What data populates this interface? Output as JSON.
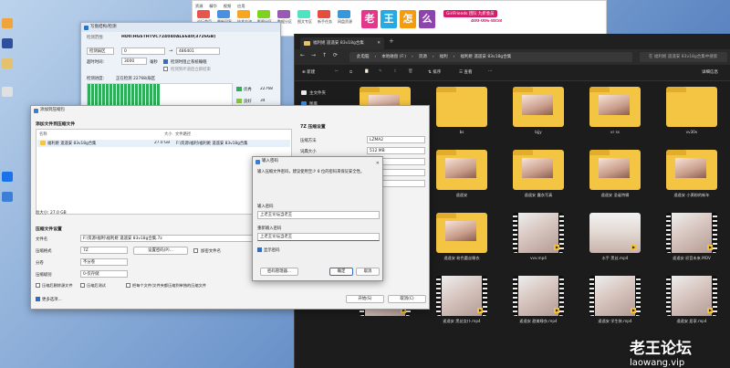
{
  "desktop": {
    "icon_colors": [
      "#f0a43a",
      "#2f4f9c",
      "#e4c16a",
      "#e0e0e0",
      "#1a73e8",
      "#3b7fd6"
    ]
  },
  "browser": {
    "nav_links": [
      "资源",
      "精华",
      "视频",
      "应用"
    ],
    "nav_labels": [
      "论坛首页",
      "最新回复",
      "技术交流",
      "影视分区",
      "数据分区",
      "图文专区",
      "新手任务",
      "网盘资源",
      "资源分区",
      "个人中心",
      "签到",
      "设置"
    ],
    "banner_glyphs": [
      "老",
      "王",
      "怎",
      "么"
    ],
    "banner_tag": "GirlFriends 团队 九折会员",
    "banner_phone": "400-006-8858"
  },
  "disk_window": {
    "title": "写盘结构/检测",
    "disk_label": "HD0:HGSTHTVC724040ALE640(3726GB)",
    "mode_label": "检测范围",
    "mode_value": "检测扇区",
    "start_value": "0",
    "arrow": "→",
    "end_value": "486401",
    "timeout_label": "超时时间:",
    "timeout_value": "3000",
    "timeout_unit": "毫秒",
    "option1": "检测时阻止系统睡眠",
    "option2": "检测到坏道后立即结束",
    "progress_label": "检测进度:",
    "progress_status": "正在检测 22768/扇区",
    "progress_fraction": 0.5,
    "legend": [
      {
        "label": "优秀",
        "value": "22768"
      },
      {
        "label": "良好",
        "value": "34"
      }
    ]
  },
  "explorer": {
    "tab_title": "福利姬 遥遥安 83v18g合集",
    "breadcrumb": [
      "此电脑",
      "本地磁盘 (F:)",
      "资源",
      "福利",
      "福利姬 遥遥安 83v18g合集"
    ],
    "search_placeholder": "在 福利姬 遥遥安 83v18g合集中搜索",
    "commands": {
      "new": "新建",
      "sort": "排序",
      "view": "查看",
      "details": "详细信息"
    },
    "nav": [
      {
        "label": "主文件夹",
        "color": "#e8e8e8"
      },
      {
        "label": "图库",
        "color": "#3b8be0"
      }
    ],
    "items": [
      {
        "name": "",
        "type": "folder-photo"
      },
      {
        "name": "bs",
        "type": "folder"
      },
      {
        "name": "bjjy",
        "type": "folder-photo"
      },
      {
        "name": "vr ss",
        "type": "folder-photo"
      },
      {
        "name": "vv30v",
        "type": "folder"
      },
      {
        "name": "",
        "type": "folder-photo"
      },
      {
        "name": "遥遥安",
        "type": "folder-photo"
      },
      {
        "name": "遥遥安 露衣写真",
        "type": "folder-photo"
      },
      {
        "name": "遥遥安 圣诞特辑",
        "type": "folder-photo"
      },
      {
        "name": "遥遥安 小黄粉的新年",
        "type": "folder-photo"
      },
      {
        "name": "",
        "type": "folder"
      },
      {
        "name": "遥遥安 粉色蕾丝睡衣",
        "type": "folder-photo"
      },
      {
        "name": "vvv.mp4",
        "type": "video"
      },
      {
        "name": "水手 黑丝.mp4",
        "type": "portrait"
      },
      {
        "name": "遥遥安 初音未来.MOV",
        "type": "video"
      },
      {
        "name": "",
        "type": "video"
      },
      {
        "name": "遥遥安 黑丝女仆.mp4",
        "type": "video"
      },
      {
        "name": "遥遥安 甜美睡衣.mp4",
        "type": "video"
      },
      {
        "name": "遥遥安 学生装.mp4",
        "type": "video"
      },
      {
        "name": "遥遥安 居家.mp4",
        "type": "video"
      }
    ]
  },
  "archive_dialog": {
    "title": "添加到压缩包",
    "section_files": "添加文件到压缩文件",
    "columns": [
      "名称",
      "大小",
      "文件路径"
    ],
    "rows": [
      {
        "name": "福利姬 遥遥安 83v18g合集",
        "size": "27.0 GB",
        "path": "F:\\资源\\福利\\福利姬 遥遥安 83v18g合集"
      }
    ],
    "total": "总大小: 27.0 GB",
    "add_btn": "添加(A)",
    "section_settings": "压缩文件设置",
    "fields": [
      {
        "label": "文件名",
        "value": "F:\\资源\\福利\\福利姬 遥遥安 83v18g合集.7z"
      },
      {
        "label": "压缩格式",
        "value": "7Z"
      },
      {
        "label": "分卷",
        "value": "不分卷"
      },
      {
        "label": "压缩级别",
        "value": "0-仅存储"
      }
    ],
    "set_pwd_btn": "设置密码(P)...",
    "encrypt_name": "加密文件名",
    "opt_delete": "压缩后删除源文件",
    "opt_test": "压缩后测试",
    "opt_pack": "把每个文件/文件夹都压缩到单独的压缩文件",
    "zip7_title": "7Z 压缩设置",
    "zip7_rows": [
      {
        "label": "压缩方法",
        "value": "LZMA2"
      },
      {
        "label": "词典大小",
        "value": "512 MB"
      },
      {
        "label": "单词大小",
        "value": "64"
      },
      {
        "label": "固实数据大小",
        "value": "16 GB"
      },
      {
        "label": "CPU线程数",
        "value": "2"
      }
    ],
    "more_opts": "更多选项...",
    "start_btn": "开始(S)",
    "cancel_btn": "取消(C)"
  },
  "password_dialog": {
    "title": "输入密码",
    "prompt": "输入压缩文件密码，建议使用至少 8 位的密码来保证安全性。",
    "label1": "输入密码",
    "value1": "上老王论坛当老王",
    "label2": "重新输入密码",
    "value2": "上老王论坛当老王",
    "show_pwd": "显示密码",
    "manage_btn": "密码管理器...",
    "ok_btn": "确定",
    "cancel_btn": "取消"
  },
  "watermark": {
    "cn": "老王论坛",
    "url": "laowang.vip"
  }
}
